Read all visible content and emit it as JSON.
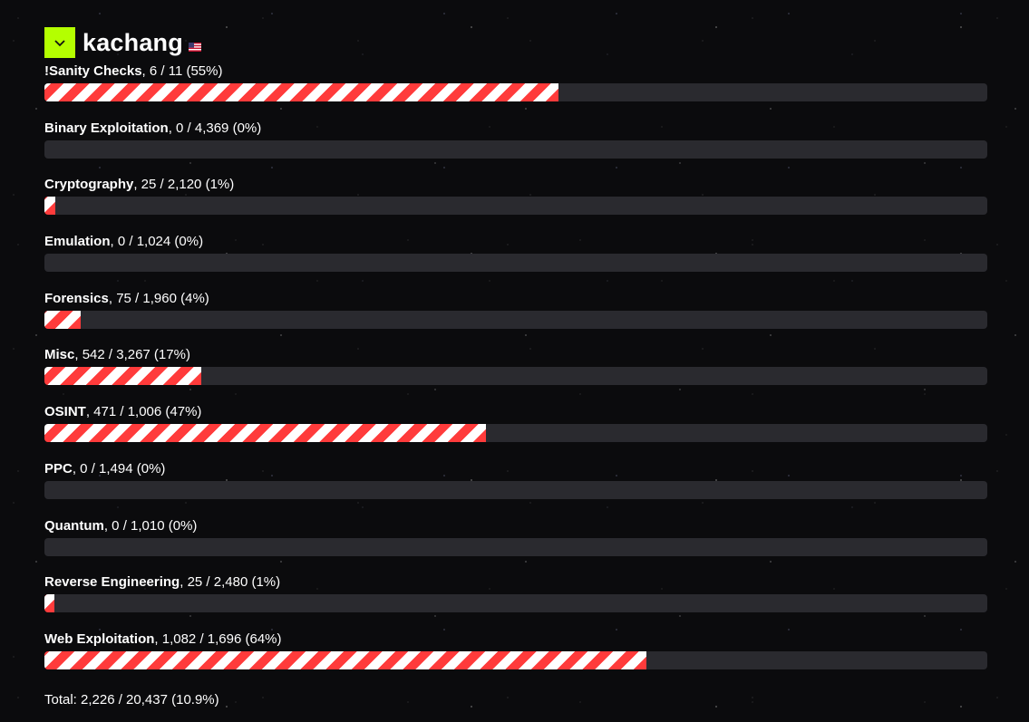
{
  "user": {
    "name": "kachang",
    "flag_icon": "us-flag-icon",
    "toggle_icon": "chevron-down-icon",
    "accent_color": "#b4ff00"
  },
  "colors": {
    "stripe_red": "#ff3b3b",
    "stripe_white": "#ffffff",
    "track": "#2a2a2f"
  },
  "categories": [
    {
      "name": "!Sanity Checks",
      "stats": ", 6 / 11 (55%)",
      "fraction": 0.545
    },
    {
      "name": "Binary Exploitation",
      "stats": ", 0 / 4,369 (0%)",
      "fraction": 0
    },
    {
      "name": "Cryptography",
      "stats": ", 25 / 2,120 (1%)",
      "fraction": 0.0118
    },
    {
      "name": "Emulation",
      "stats": ", 0 / 1,024 (0%)",
      "fraction": 0
    },
    {
      "name": "Forensics",
      "stats": ", 75 / 1,960 (4%)",
      "fraction": 0.0383
    },
    {
      "name": "Misc",
      "stats": ", 542 / 3,267 (17%)",
      "fraction": 0.1659
    },
    {
      "name": "OSINT",
      "stats": ", 471 / 1,006 (47%)",
      "fraction": 0.4682
    },
    {
      "name": "PPC",
      "stats": ", 0 / 1,494 (0%)",
      "fraction": 0
    },
    {
      "name": "Quantum",
      "stats": ", 0 / 1,010 (0%)",
      "fraction": 0
    },
    {
      "name": "Reverse Engineering",
      "stats": ", 25 / 2,480 (1%)",
      "fraction": 0.0101
    },
    {
      "name": "Web Exploitation",
      "stats": ", 1,082 / 1,696 (64%)",
      "fraction": 0.638
    }
  ],
  "total": "Total: 2,226 / 20,437 (10.9%)"
}
